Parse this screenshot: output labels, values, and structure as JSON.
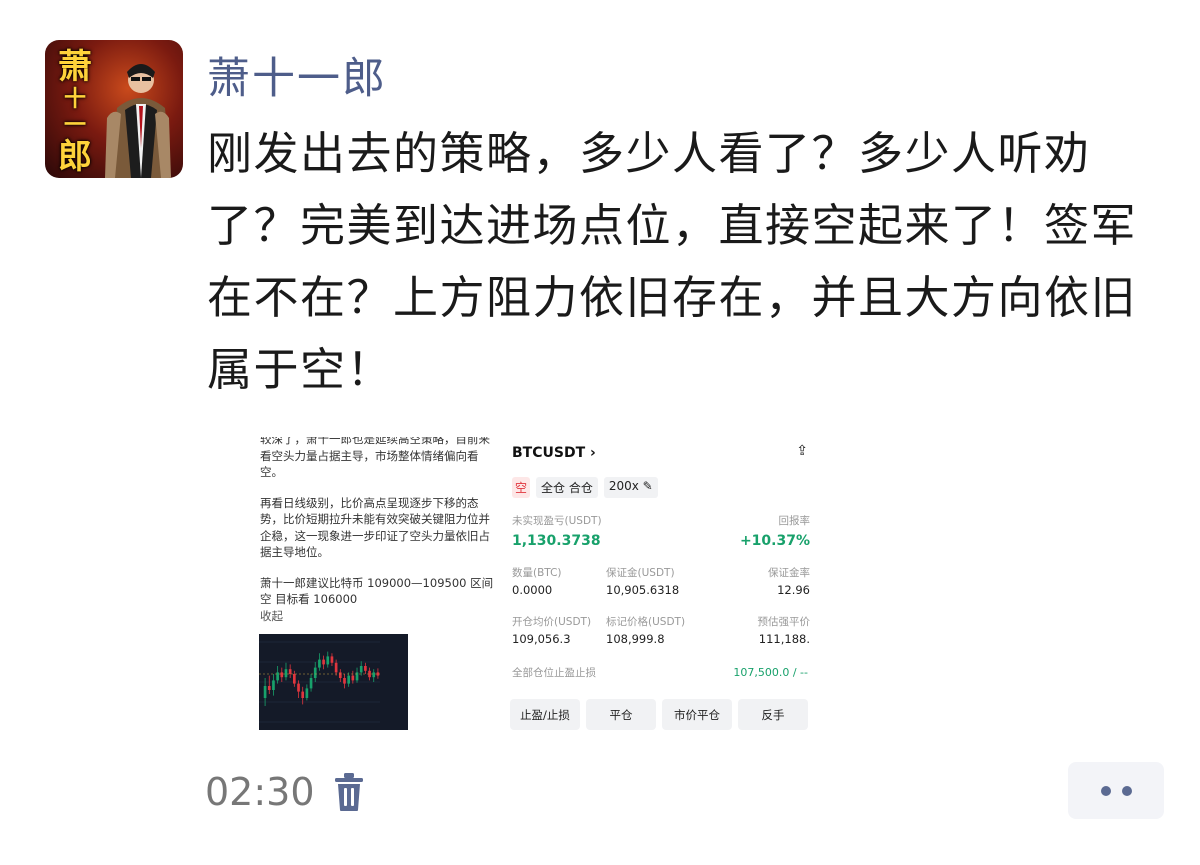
{
  "author": {
    "name": "萧十一郎",
    "avatar_text": [
      "萧",
      "十",
      "一",
      "郎"
    ]
  },
  "message": {
    "text": "刚发出去的策略，多少人看了？多少人听劝了？完美到达进场点位，直接空起来了！签军在不在？上方阻力依旧存在，并且大方向依旧属于空！"
  },
  "attachments": {
    "left": {
      "paragraphs": [
        "较深了，萧十一郎也是延续高空策略，目前来看空头力量占据主导，市场整体情绪偏向看空。",
        "再看日线级别，比价高点呈现逐步下移的态势，比价短期拉升未能有效突破关键阻力位并企稳，这一现象进一步印证了空头力量依旧占据主导地位。",
        "萧十一郎建议比特币 109000—109500 区间空 目标看 106000"
      ],
      "collapse_label": "收起",
      "mini_chart": {
        "type": "candlestick",
        "candles": [
          [
            0.3,
            0.45,
            0.55,
            0.2,
            0
          ],
          [
            0.45,
            0.4,
            0.58,
            0.35,
            1
          ],
          [
            0.4,
            0.52,
            0.6,
            0.33,
            0
          ],
          [
            0.52,
            0.62,
            0.7,
            0.48,
            0
          ],
          [
            0.62,
            0.56,
            0.68,
            0.5,
            1
          ],
          [
            0.56,
            0.66,
            0.74,
            0.52,
            0
          ],
          [
            0.66,
            0.6,
            0.72,
            0.55,
            1
          ],
          [
            0.6,
            0.48,
            0.64,
            0.44,
            1
          ],
          [
            0.48,
            0.38,
            0.52,
            0.3,
            1
          ],
          [
            0.38,
            0.3,
            0.44,
            0.22,
            1
          ],
          [
            0.3,
            0.42,
            0.47,
            0.27,
            0
          ],
          [
            0.42,
            0.55,
            0.6,
            0.38,
            0
          ],
          [
            0.55,
            0.68,
            0.75,
            0.5,
            0
          ],
          [
            0.68,
            0.78,
            0.86,
            0.64,
            0
          ],
          [
            0.78,
            0.72,
            0.83,
            0.66,
            1
          ],
          [
            0.72,
            0.82,
            0.88,
            0.68,
            0
          ],
          [
            0.82,
            0.74,
            0.86,
            0.7,
            1
          ],
          [
            0.74,
            0.62,
            0.78,
            0.58,
            1
          ],
          [
            0.62,
            0.55,
            0.66,
            0.5,
            1
          ],
          [
            0.55,
            0.48,
            0.6,
            0.42,
            1
          ],
          [
            0.48,
            0.58,
            0.62,
            0.44,
            0
          ],
          [
            0.58,
            0.52,
            0.64,
            0.48,
            1
          ],
          [
            0.52,
            0.62,
            0.68,
            0.49,
            0
          ],
          [
            0.62,
            0.7,
            0.76,
            0.58,
            0
          ],
          [
            0.7,
            0.64,
            0.74,
            0.6,
            1
          ],
          [
            0.64,
            0.56,
            0.68,
            0.52,
            1
          ],
          [
            0.56,
            0.62,
            0.66,
            0.5,
            0
          ],
          [
            0.62,
            0.58,
            0.67,
            0.54,
            1
          ]
        ]
      }
    },
    "right": {
      "symbol": "BTCUSDT",
      "tags": [
        "空",
        "全仓 合仓",
        "200x"
      ],
      "pnl_label": "未实现盈亏(USDT)",
      "pnl_value": "1,130.3738",
      "roe_label": "回报率",
      "roe_value": "+10.37%",
      "row1": [
        {
          "label": "数量(BTC)",
          "value": "0.0000"
        },
        {
          "label": "保证金(USDT)",
          "value": "10,905.6318"
        },
        {
          "label": "保证金率",
          "value": "12.96"
        }
      ],
      "row2": [
        {
          "label": "开仓均价(USDT)",
          "value": "109,056.3"
        },
        {
          "label": "标记价格(USDT)",
          "value": "108,999.8"
        },
        {
          "label": "预估强平价",
          "value": "111,188."
        }
      ],
      "tpsl_label": "全部仓位止盈止损",
      "tpsl_value": "107,500.0 / --",
      "actions": [
        "止盈/止损",
        "平仓",
        "市价平仓",
        "反手"
      ]
    }
  },
  "footer": {
    "time": "02:30"
  },
  "colors": {
    "author": "#4e5d8a",
    "profit": "#18a16b",
    "short": "#e0363e"
  }
}
